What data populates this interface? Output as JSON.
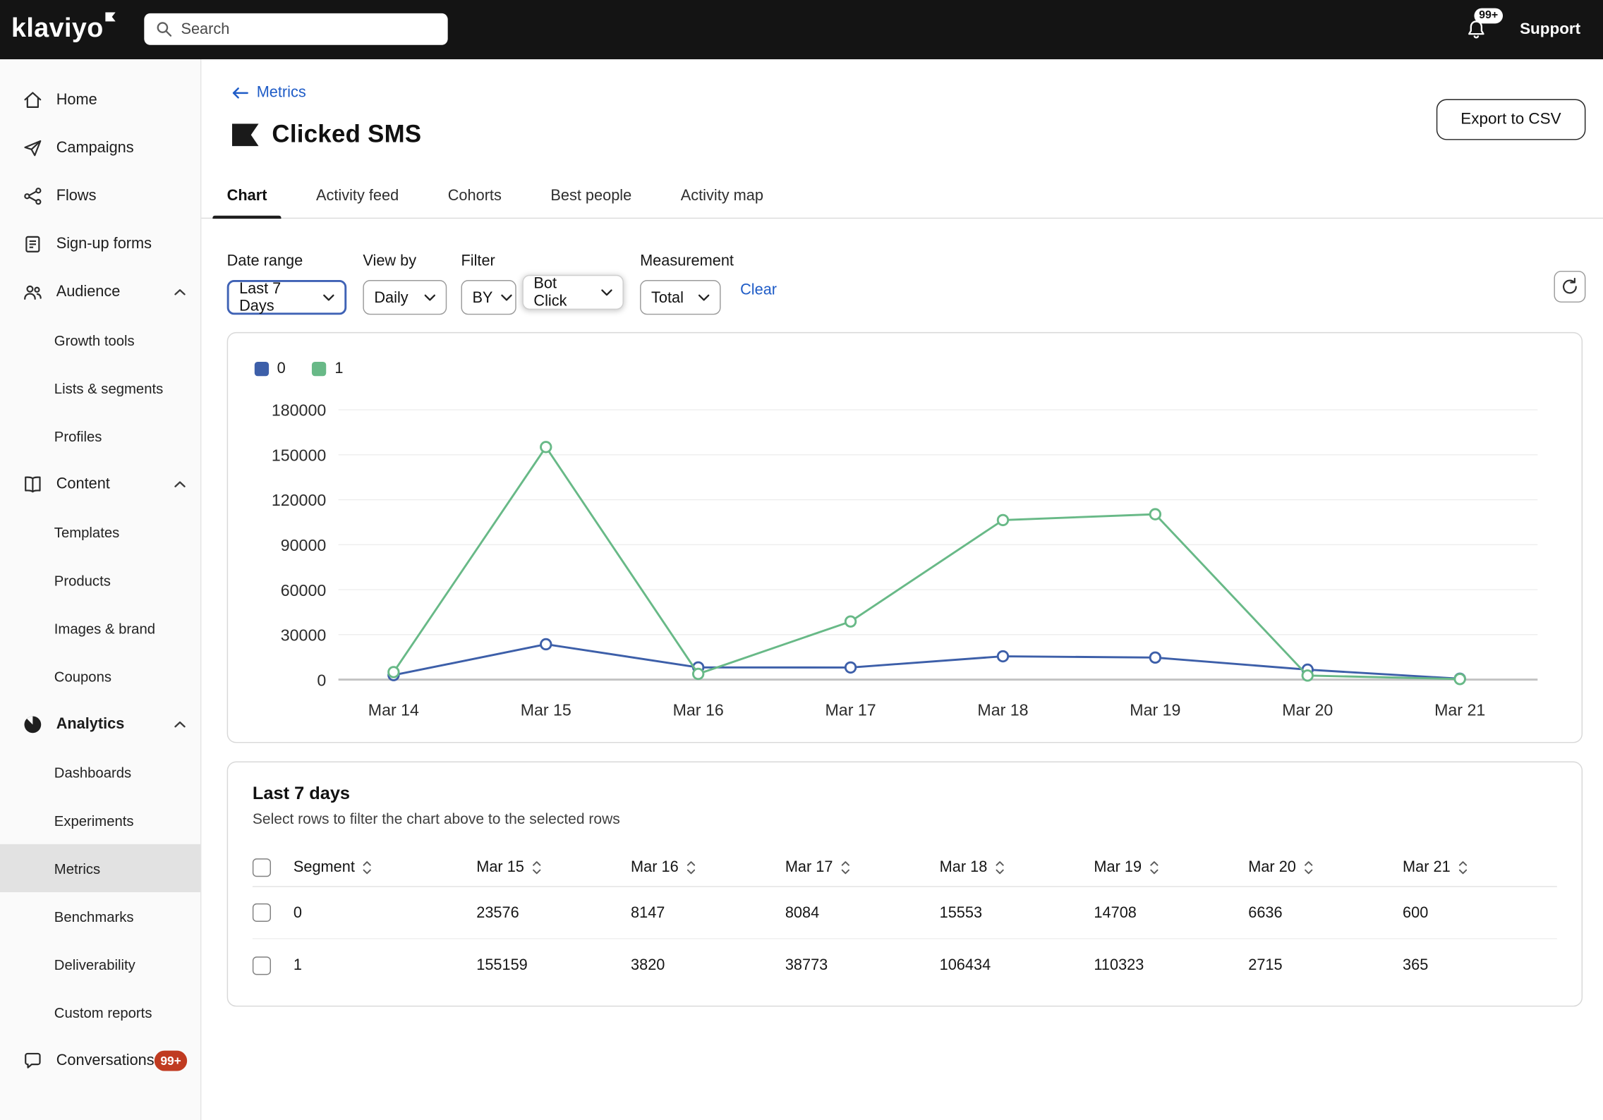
{
  "topbar": {
    "logo": "klaviyo",
    "search": {
      "placeholder": "Search"
    },
    "notifications_badge": "99+",
    "support_label": "Support"
  },
  "sidebar": {
    "items": [
      {
        "label": "Home",
        "icon": "home-icon",
        "type": "top"
      },
      {
        "label": "Campaigns",
        "icon": "campaigns-icon",
        "type": "top"
      },
      {
        "label": "Flows",
        "icon": "flows-icon",
        "type": "top"
      },
      {
        "label": "Sign-up forms",
        "icon": "signup-forms-icon",
        "type": "top"
      },
      {
        "label": "Audience",
        "icon": "audience-icon",
        "type": "top",
        "expanded": true
      },
      {
        "label": "Growth tools",
        "type": "sub"
      },
      {
        "label": "Lists & segments",
        "type": "sub"
      },
      {
        "label": "Profiles",
        "type": "sub"
      },
      {
        "label": "Content",
        "icon": "content-icon",
        "type": "top",
        "expanded": true
      },
      {
        "label": "Templates",
        "type": "sub"
      },
      {
        "label": "Products",
        "type": "sub"
      },
      {
        "label": "Images & brand",
        "type": "sub"
      },
      {
        "label": "Coupons",
        "type": "sub"
      },
      {
        "label": "Analytics",
        "icon": "analytics-icon",
        "type": "top",
        "expanded": true,
        "active": true
      },
      {
        "label": "Dashboards",
        "type": "sub"
      },
      {
        "label": "Experiments",
        "type": "sub"
      },
      {
        "label": "Metrics",
        "type": "sub",
        "selected": true
      },
      {
        "label": "Benchmarks",
        "type": "sub"
      },
      {
        "label": "Deliverability",
        "type": "sub"
      },
      {
        "label": "Custom reports",
        "type": "sub"
      },
      {
        "label": "Conversations",
        "icon": "conversations-icon",
        "type": "top",
        "badge": "99+"
      }
    ]
  },
  "header": {
    "back_label": "Metrics",
    "title": "Clicked SMS",
    "export_button_label": "Export to CSV"
  },
  "tabs": [
    {
      "label": "Chart",
      "active": true
    },
    {
      "label": "Activity feed",
      "active": false
    },
    {
      "label": "Cohorts",
      "active": false
    },
    {
      "label": "Best people",
      "active": false
    },
    {
      "label": "Activity map",
      "active": false
    }
  ],
  "filters": {
    "date_range": {
      "label": "Date range",
      "value": "Last 7 Days"
    },
    "view_by": {
      "label": "View by",
      "value": "Daily"
    },
    "filter": {
      "label": "Filter",
      "value": "BY",
      "value2": "Bot Click"
    },
    "measurement": {
      "label": "Measurement",
      "value": "Total"
    },
    "clear_label": "Clear"
  },
  "chart_data": {
    "type": "line",
    "title": "",
    "xlabel": "",
    "ylabel": "",
    "categories": [
      "Mar 14",
      "Mar 15",
      "Mar 16",
      "Mar 17",
      "Mar 18",
      "Mar 19",
      "Mar 20",
      "Mar 21"
    ],
    "series": [
      {
        "name": "0",
        "color": "#3d5fa9",
        "values": [
          3000,
          23576,
          8147,
          8084,
          15553,
          14708,
          6636,
          600
        ]
      },
      {
        "name": "1",
        "color": "#68b987",
        "values": [
          5000,
          155159,
          3820,
          38773,
          106434,
          110323,
          2715,
          365
        ]
      }
    ],
    "ylim": [
      0,
      180000
    ],
    "ytick_step": 30000,
    "grid": true,
    "legend_position": "top-left",
    "marker": "circle-open"
  },
  "table": {
    "title": "Last 7 days",
    "subtitle": "Select rows to filter the chart above to the selected rows",
    "columns": [
      "Segment",
      "Mar 15",
      "Mar 16",
      "Mar 17",
      "Mar 18",
      "Mar 19",
      "Mar 20",
      "Mar 21"
    ],
    "rows": [
      {
        "segment": "0",
        "values": [
          "23576",
          "8147",
          "8084",
          "15553",
          "14708",
          "6636",
          "600"
        ]
      },
      {
        "segment": "1",
        "values": [
          "155159",
          "3820",
          "38773",
          "106434",
          "110323",
          "2715",
          "365"
        ]
      }
    ]
  },
  "colors": {
    "topbar_bg": "#141414",
    "link_blue": "#1f5cc7",
    "series_0": "#3d5fa9",
    "series_1": "#68b987",
    "badge_red": "#c03b21",
    "sidebar_selected": "#e2e2e2"
  }
}
